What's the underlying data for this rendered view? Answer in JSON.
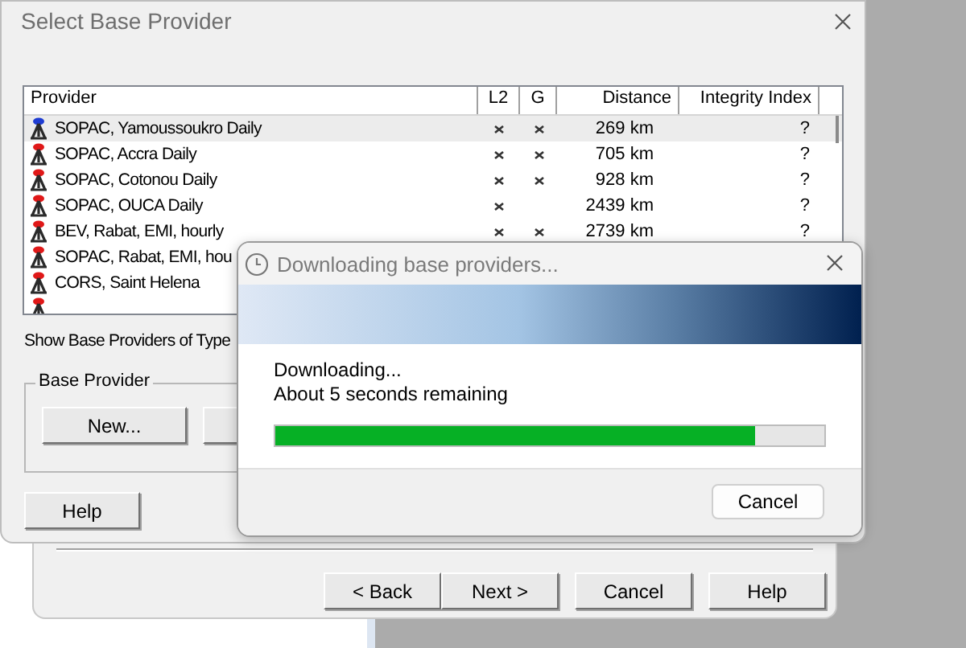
{
  "wizard": {
    "buttons": [
      {
        "label": "< Back"
      },
      {
        "label": "Next >"
      },
      {
        "label": "Cancel"
      },
      {
        "label": "Help"
      }
    ]
  },
  "dialog": {
    "title": "Select Base Provider",
    "table": {
      "columns": [
        "Provider",
        "L2",
        "G",
        "Distance",
        "Integrity Index"
      ],
      "rows": [
        {
          "provider": "SOPAC, Yamoussoukro Daily",
          "color": "#1e3cd2",
          "l2": true,
          "g": true,
          "distance": "269 km",
          "integrity": "?",
          "selected": true
        },
        {
          "provider": "SOPAC, Accra Daily",
          "color": "#e01818",
          "l2": true,
          "g": true,
          "distance": "705 km",
          "integrity": "?",
          "selected": false
        },
        {
          "provider": "SOPAC, Cotonou Daily",
          "color": "#e01818",
          "l2": true,
          "g": true,
          "distance": "928 km",
          "integrity": "?",
          "selected": false
        },
        {
          "provider": "SOPAC, OUCA Daily",
          "color": "#e01818",
          "l2": true,
          "g": false,
          "distance": "2439 km",
          "integrity": "?",
          "selected": false
        },
        {
          "provider": "BEV, Rabat, EMI, hourly",
          "color": "#e01818",
          "l2": true,
          "g": true,
          "distance": "2739 km",
          "integrity": "?",
          "selected": false
        },
        {
          "provider": "SOPAC, Rabat, EMI, hou",
          "color": "#e01818",
          "selected": false
        },
        {
          "provider": "CORS, Saint Helena",
          "color": "#e01818",
          "selected": false
        },
        {
          "color": "#e01818",
          "selected": false
        }
      ]
    },
    "filter_label": "Show Base Providers of Type",
    "group": {
      "title": "Base Provider",
      "buttons": [
        "New..."
      ]
    },
    "help_button": "Help"
  },
  "progress": {
    "title": "Downloading base providers...",
    "status": "Downloading...",
    "remaining": "About 5 seconds remaining",
    "level": 0.875,
    "button": "Cancel"
  }
}
